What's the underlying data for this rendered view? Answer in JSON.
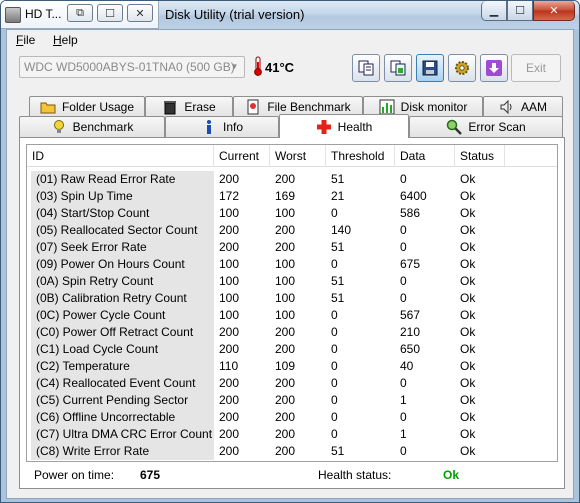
{
  "window": {
    "app_short_title": "HD T...",
    "title": "Disk Utility (trial version)"
  },
  "menu": [
    {
      "label": "File"
    },
    {
      "label": "Help"
    }
  ],
  "drive": {
    "selected": "WDC WD5000ABYS-01TNA0 (500 GB)",
    "temperature": "41°C"
  },
  "toolbar": {
    "exit_label": "Exit"
  },
  "tabs_row1": [
    {
      "label": "Folder Usage",
      "icon": "folder-icon"
    },
    {
      "label": "Erase",
      "icon": "trash-icon"
    },
    {
      "label": "File Benchmark",
      "icon": "file-benchmark-icon"
    },
    {
      "label": "Disk monitor",
      "icon": "bar-chart-icon"
    },
    {
      "label": "AAM",
      "icon": "speaker-icon"
    }
  ],
  "tabs_row2": [
    {
      "label": "Benchmark",
      "icon": "lightbulb-icon"
    },
    {
      "label": "Info",
      "icon": "info-icon"
    },
    {
      "label": "Health",
      "icon": "red-cross-icon",
      "active": true
    },
    {
      "label": "Error Scan",
      "icon": "magnifier-icon"
    }
  ],
  "table": {
    "columns": [
      "ID",
      "Current",
      "Worst",
      "Threshold",
      "Data",
      "Status"
    ],
    "rows": [
      [
        "(01) Raw Read Error Rate",
        "200",
        "200",
        "51",
        "0",
        "Ok"
      ],
      [
        "(03) Spin Up Time",
        "172",
        "169",
        "21",
        "6400",
        "Ok"
      ],
      [
        "(04) Start/Stop Count",
        "100",
        "100",
        "0",
        "586",
        "Ok"
      ],
      [
        "(05) Reallocated Sector Count",
        "200",
        "200",
        "140",
        "0",
        "Ok"
      ],
      [
        "(07) Seek Error Rate",
        "200",
        "200",
        "51",
        "0",
        "Ok"
      ],
      [
        "(09) Power On Hours Count",
        "100",
        "100",
        "0",
        "675",
        "Ok"
      ],
      [
        "(0A) Spin Retry Count",
        "100",
        "100",
        "51",
        "0",
        "Ok"
      ],
      [
        "(0B) Calibration Retry Count",
        "100",
        "100",
        "51",
        "0",
        "Ok"
      ],
      [
        "(0C) Power Cycle Count",
        "100",
        "100",
        "0",
        "567",
        "Ok"
      ],
      [
        "(C0) Power Off Retract Count",
        "200",
        "200",
        "0",
        "210",
        "Ok"
      ],
      [
        "(C1) Load Cycle Count",
        "200",
        "200",
        "0",
        "650",
        "Ok"
      ],
      [
        "(C2) Temperature",
        "110",
        "109",
        "0",
        "40",
        "Ok"
      ],
      [
        "(C4) Reallocated Event Count",
        "200",
        "200",
        "0",
        "0",
        "Ok"
      ],
      [
        "(C5) Current Pending Sector",
        "200",
        "200",
        "0",
        "1",
        "Ok"
      ],
      [
        "(C6) Offline Uncorrectable",
        "200",
        "200",
        "0",
        "0",
        "Ok"
      ],
      [
        "(C7) Ultra DMA CRC Error Count",
        "200",
        "200",
        "0",
        "1",
        "Ok"
      ],
      [
        "(C8) Write Error Rate",
        "200",
        "200",
        "51",
        "0",
        "Ok"
      ]
    ]
  },
  "footer": {
    "power_on_label": "Power on time:",
    "power_on_value": "675",
    "health_label": "Health status:",
    "health_value": "Ok",
    "health_color": "#00a000"
  }
}
